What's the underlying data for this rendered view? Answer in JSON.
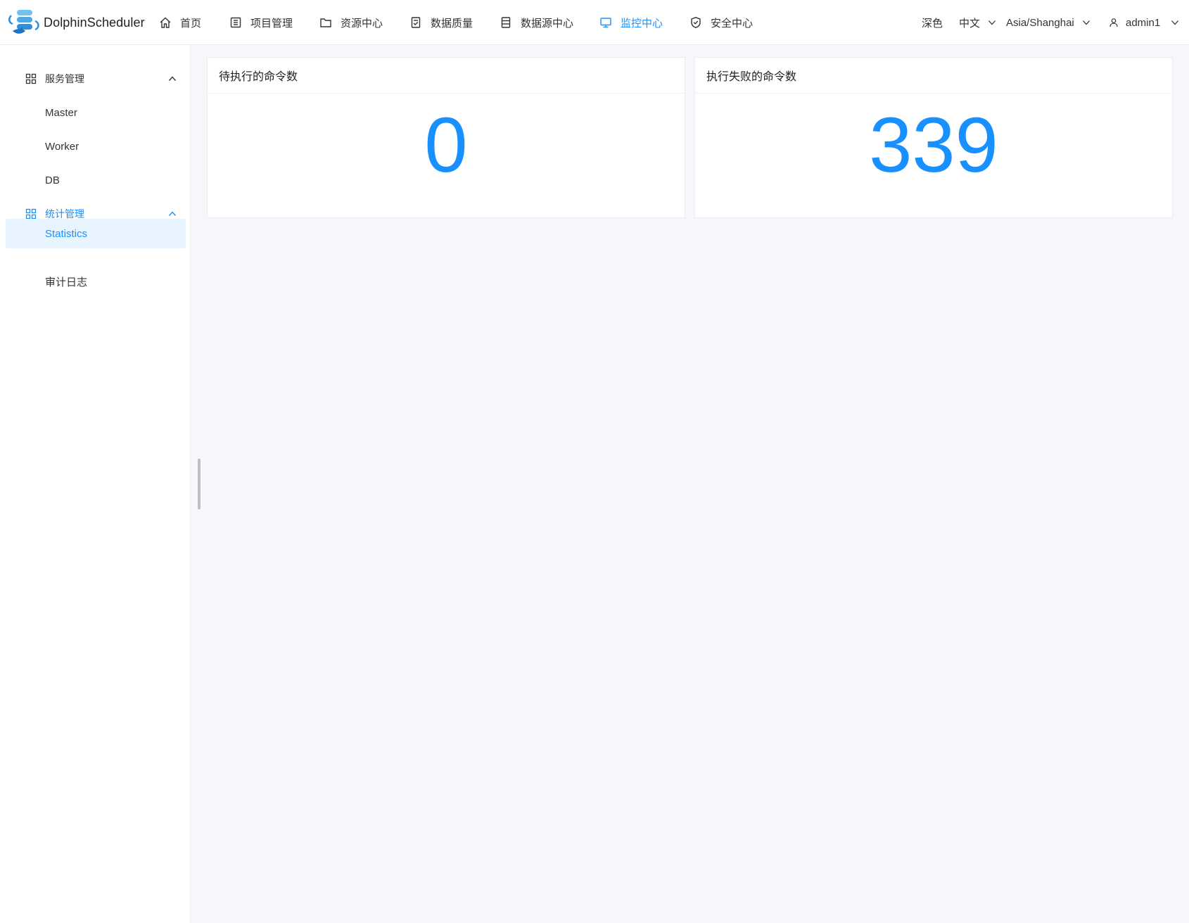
{
  "app": {
    "name": "DolphinScheduler"
  },
  "nav": {
    "items": [
      {
        "label": "首页",
        "icon": "home-icon"
      },
      {
        "label": "项目管理",
        "icon": "project-icon"
      },
      {
        "label": "资源中心",
        "icon": "folder-icon"
      },
      {
        "label": "数据质量",
        "icon": "document-icon"
      },
      {
        "label": "数据源中心",
        "icon": "datasource-icon"
      },
      {
        "label": "监控中心",
        "icon": "monitor-icon",
        "active": true
      },
      {
        "label": "安全中心",
        "icon": "shield-icon"
      }
    ]
  },
  "header_right": {
    "theme": "深色",
    "language": "中文",
    "timezone": "Asia/Shanghai",
    "user": "admin1"
  },
  "sidebar": {
    "groups": [
      {
        "label": "服务管理",
        "expanded": true,
        "items": [
          {
            "label": "Master"
          },
          {
            "label": "Worker"
          },
          {
            "label": "DB"
          }
        ]
      },
      {
        "label": "统计管理",
        "expanded": true,
        "active": true,
        "items": [
          {
            "label": "Statistics",
            "active": true
          },
          {
            "label": "审计日志"
          }
        ]
      }
    ]
  },
  "cards": [
    {
      "title": "待执行的命令数",
      "value": "0"
    },
    {
      "title": "执行失败的命令数",
      "value": "339"
    }
  ],
  "colors": {
    "accent": "#1890ff",
    "active_bg": "#e8f4ff",
    "page_bg": "#f6f7fb"
  }
}
